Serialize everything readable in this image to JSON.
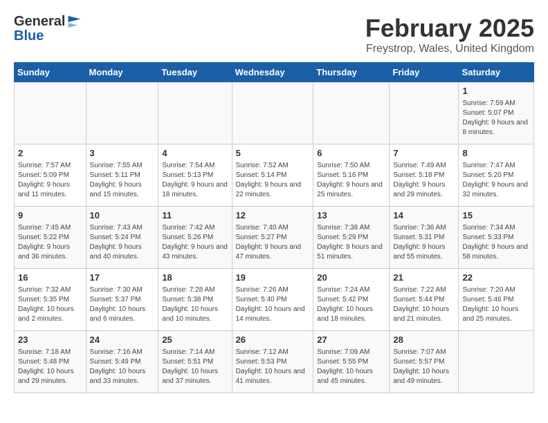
{
  "header": {
    "logo_line1": "General",
    "logo_line2": "Blue",
    "title": "February 2025",
    "subtitle": "Freystrop, Wales, United Kingdom"
  },
  "days_of_week": [
    "Sunday",
    "Monday",
    "Tuesday",
    "Wednesday",
    "Thursday",
    "Friday",
    "Saturday"
  ],
  "weeks": [
    [
      {
        "day": "",
        "info": ""
      },
      {
        "day": "",
        "info": ""
      },
      {
        "day": "",
        "info": ""
      },
      {
        "day": "",
        "info": ""
      },
      {
        "day": "",
        "info": ""
      },
      {
        "day": "",
        "info": ""
      },
      {
        "day": "1",
        "info": "Sunrise: 7:59 AM\nSunset: 5:07 PM\nDaylight: 9 hours and 8 minutes."
      }
    ],
    [
      {
        "day": "2",
        "info": "Sunrise: 7:57 AM\nSunset: 5:09 PM\nDaylight: 9 hours and 11 minutes."
      },
      {
        "day": "3",
        "info": "Sunrise: 7:55 AM\nSunset: 5:11 PM\nDaylight: 9 hours and 15 minutes."
      },
      {
        "day": "4",
        "info": "Sunrise: 7:54 AM\nSunset: 5:13 PM\nDaylight: 9 hours and 18 minutes."
      },
      {
        "day": "5",
        "info": "Sunrise: 7:52 AM\nSunset: 5:14 PM\nDaylight: 9 hours and 22 minutes."
      },
      {
        "day": "6",
        "info": "Sunrise: 7:50 AM\nSunset: 5:16 PM\nDaylight: 9 hours and 25 minutes."
      },
      {
        "day": "7",
        "info": "Sunrise: 7:49 AM\nSunset: 5:18 PM\nDaylight: 9 hours and 29 minutes."
      },
      {
        "day": "8",
        "info": "Sunrise: 7:47 AM\nSunset: 5:20 PM\nDaylight: 9 hours and 32 minutes."
      }
    ],
    [
      {
        "day": "9",
        "info": "Sunrise: 7:45 AM\nSunset: 5:22 PM\nDaylight: 9 hours and 36 minutes."
      },
      {
        "day": "10",
        "info": "Sunrise: 7:43 AM\nSunset: 5:24 PM\nDaylight: 9 hours and 40 minutes."
      },
      {
        "day": "11",
        "info": "Sunrise: 7:42 AM\nSunset: 5:26 PM\nDaylight: 9 hours and 43 minutes."
      },
      {
        "day": "12",
        "info": "Sunrise: 7:40 AM\nSunset: 5:27 PM\nDaylight: 9 hours and 47 minutes."
      },
      {
        "day": "13",
        "info": "Sunrise: 7:38 AM\nSunset: 5:29 PM\nDaylight: 9 hours and 51 minutes."
      },
      {
        "day": "14",
        "info": "Sunrise: 7:36 AM\nSunset: 5:31 PM\nDaylight: 9 hours and 55 minutes."
      },
      {
        "day": "15",
        "info": "Sunrise: 7:34 AM\nSunset: 5:33 PM\nDaylight: 9 hours and 58 minutes."
      }
    ],
    [
      {
        "day": "16",
        "info": "Sunrise: 7:32 AM\nSunset: 5:35 PM\nDaylight: 10 hours and 2 minutes."
      },
      {
        "day": "17",
        "info": "Sunrise: 7:30 AM\nSunset: 5:37 PM\nDaylight: 10 hours and 6 minutes."
      },
      {
        "day": "18",
        "info": "Sunrise: 7:28 AM\nSunset: 5:38 PM\nDaylight: 10 hours and 10 minutes."
      },
      {
        "day": "19",
        "info": "Sunrise: 7:26 AM\nSunset: 5:40 PM\nDaylight: 10 hours and 14 minutes."
      },
      {
        "day": "20",
        "info": "Sunrise: 7:24 AM\nSunset: 5:42 PM\nDaylight: 10 hours and 18 minutes."
      },
      {
        "day": "21",
        "info": "Sunrise: 7:22 AM\nSunset: 5:44 PM\nDaylight: 10 hours and 21 minutes."
      },
      {
        "day": "22",
        "info": "Sunrise: 7:20 AM\nSunset: 5:46 PM\nDaylight: 10 hours and 25 minutes."
      }
    ],
    [
      {
        "day": "23",
        "info": "Sunrise: 7:18 AM\nSunset: 5:48 PM\nDaylight: 10 hours and 29 minutes."
      },
      {
        "day": "24",
        "info": "Sunrise: 7:16 AM\nSunset: 5:49 PM\nDaylight: 10 hours and 33 minutes."
      },
      {
        "day": "25",
        "info": "Sunrise: 7:14 AM\nSunset: 5:51 PM\nDaylight: 10 hours and 37 minutes."
      },
      {
        "day": "26",
        "info": "Sunrise: 7:12 AM\nSunset: 5:53 PM\nDaylight: 10 hours and 41 minutes."
      },
      {
        "day": "27",
        "info": "Sunrise: 7:09 AM\nSunset: 5:55 PM\nDaylight: 10 hours and 45 minutes."
      },
      {
        "day": "28",
        "info": "Sunrise: 7:07 AM\nSunset: 5:57 PM\nDaylight: 10 hours and 49 minutes."
      },
      {
        "day": "",
        "info": ""
      }
    ]
  ]
}
